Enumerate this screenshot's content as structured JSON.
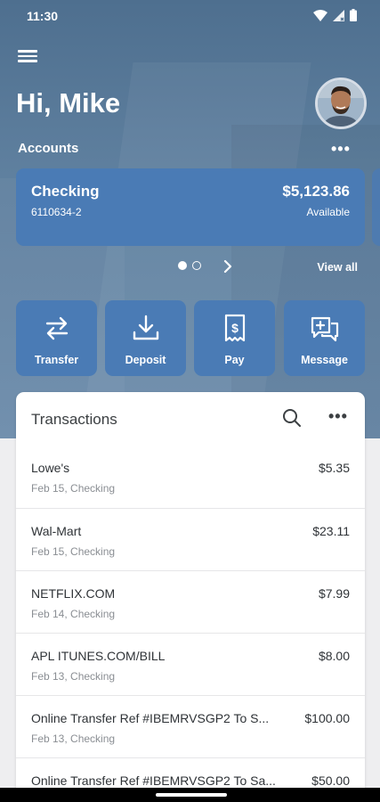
{
  "status_bar": {
    "time": "11:30"
  },
  "header": {
    "greeting": "Hi, Mike",
    "accounts_label": "Accounts",
    "accounts_more": "•••"
  },
  "account_card": {
    "name": "Checking",
    "number": "6110634-2",
    "balance": "$5,123.86",
    "balance_label": "Available"
  },
  "pager": {
    "view_all": "View all"
  },
  "actions": [
    {
      "label": "Transfer",
      "icon": "transfer-icon"
    },
    {
      "label": "Deposit",
      "icon": "deposit-icon"
    },
    {
      "label": "Pay",
      "icon": "pay-bill-icon"
    },
    {
      "label": "Message",
      "icon": "message-icon"
    }
  ],
  "transactions": {
    "title": "Transactions",
    "more": "•••",
    "items": [
      {
        "merchant": "Lowe's",
        "amount": "$5.35",
        "meta": "Feb 15, Checking"
      },
      {
        "merchant": "Wal-Mart",
        "amount": "$23.11",
        "meta": "Feb 15, Checking"
      },
      {
        "merchant": "NETFLIX.COM",
        "amount": "$7.99",
        "meta": "Feb 14, Checking"
      },
      {
        "merchant": "APL ITUNES.COM/BILL",
        "amount": "$8.00",
        "meta": "Feb 13, Checking"
      },
      {
        "merchant": "Online Transfer Ref #IBEMRVSGP2 To S...",
        "amount": "$100.00",
        "meta": "Feb 13, Checking"
      },
      {
        "merchant": "Online Transfer Ref #IBEMRVSGP2 To Sa...",
        "amount": "$50.00",
        "meta": ""
      }
    ]
  },
  "colors": {
    "hero_bg": "#5a7b9b",
    "card_blue": "#4a7bb5",
    "text_dark": "#2f3337",
    "text_muted": "#8a8e93"
  }
}
